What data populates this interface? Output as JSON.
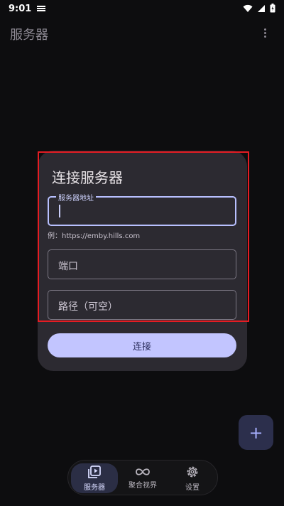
{
  "status_bar": {
    "time": "9:01"
  },
  "app_bar": {
    "title": "服务器"
  },
  "dialog": {
    "title": "连接服务器",
    "server_field": {
      "label": "服务器地址",
      "value": ""
    },
    "server_helper": "例：https://emby.hills.com",
    "port_field": {
      "placeholder": "端口"
    },
    "path_field": {
      "placeholder": "路径（可空）"
    },
    "connect_label": "连接"
  },
  "fab": {
    "icon": "plus-icon"
  },
  "bottom_nav": {
    "items": [
      {
        "label": "服务器",
        "icon": "play-library-icon",
        "active": true
      },
      {
        "label": "聚合视界",
        "icon": "infinity-icon",
        "active": false
      },
      {
        "label": "设置",
        "icon": "gear-icon",
        "active": false
      }
    ]
  },
  "colors": {
    "accent": "#c2c5ff",
    "highlight_border": "#e51c23",
    "dialog_bg": "#2c2a31"
  }
}
